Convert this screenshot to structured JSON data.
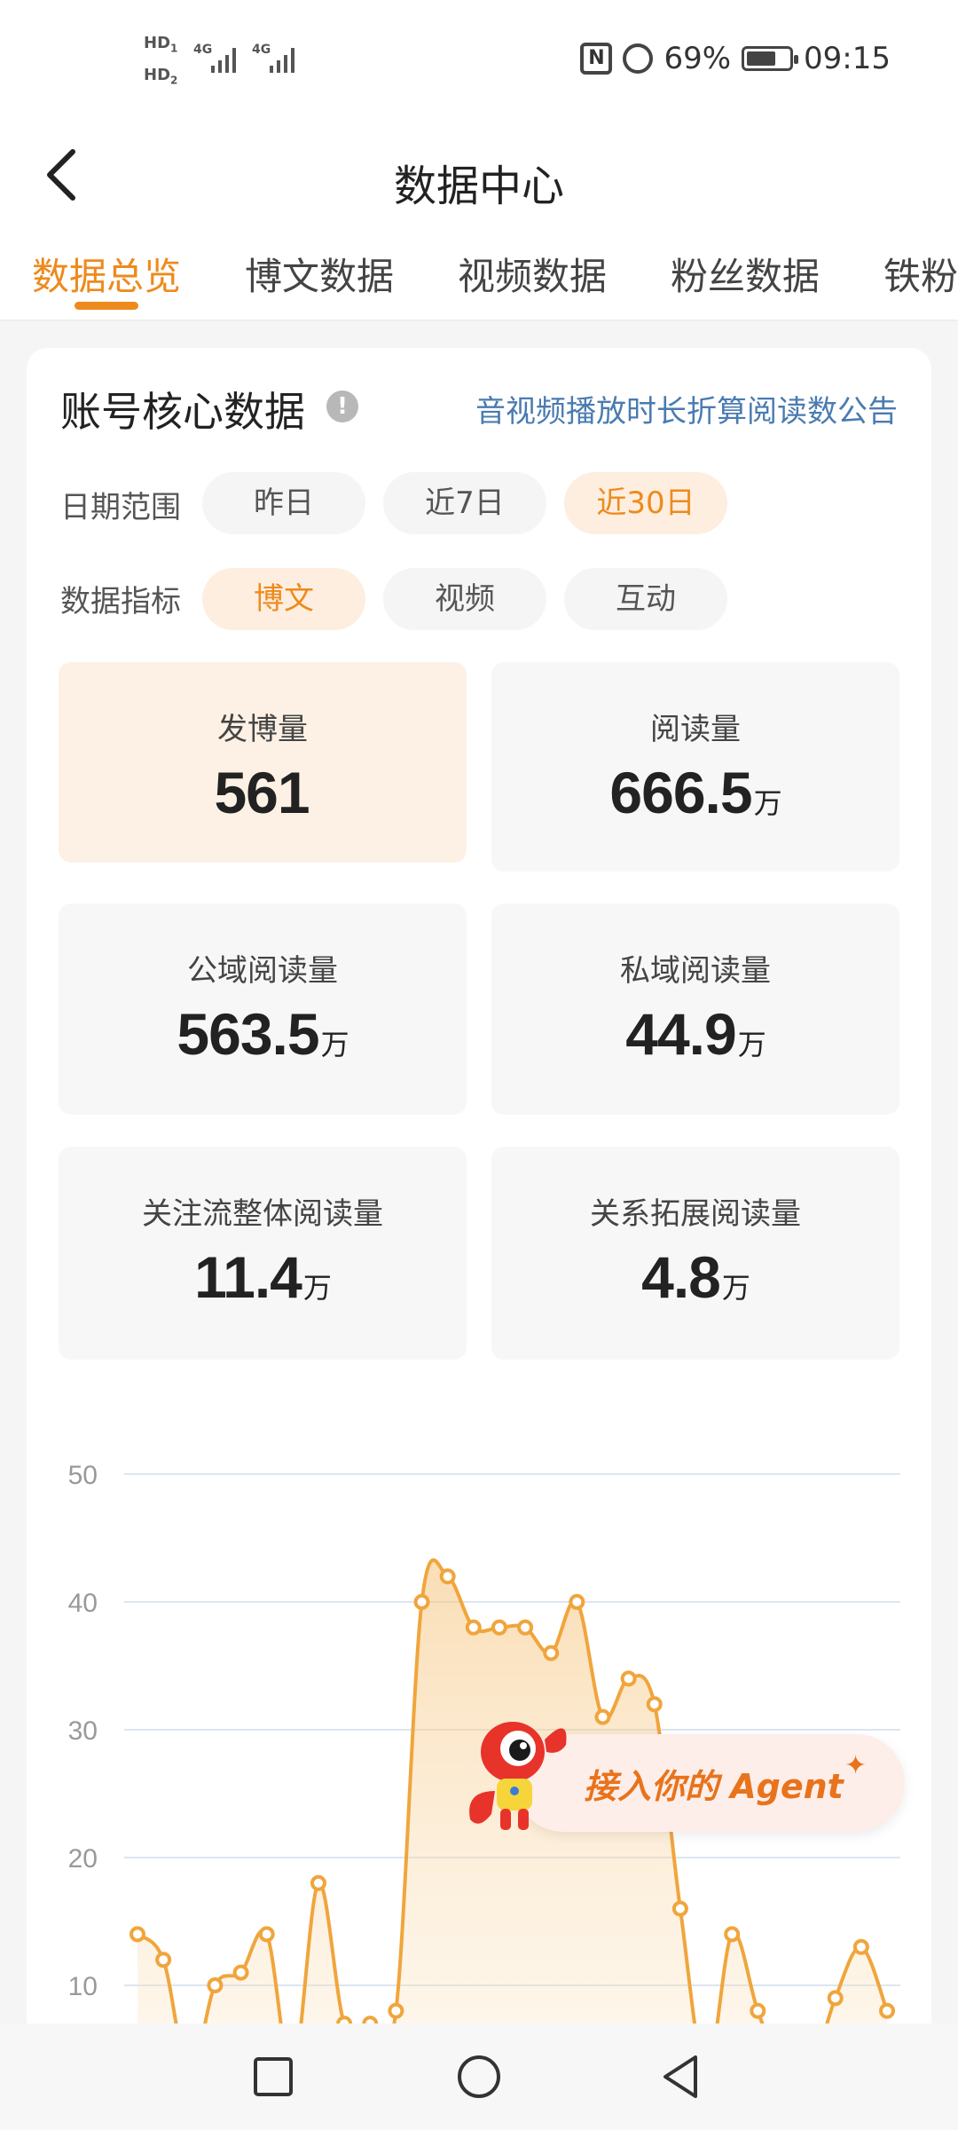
{
  "status_bar": {
    "hd1": "HD",
    "hd1_sub": "1",
    "hd2": "HD",
    "hd2_sub": "2",
    "net1": "4G",
    "net2": "4G",
    "nfc_icon": "nfc-icon",
    "battery_percent": "69%",
    "battery_level": 0.69,
    "time": "09:15"
  },
  "navbar": {
    "title": "数据中心",
    "back_icon": "chevron-left-icon"
  },
  "tabs": [
    {
      "label": "数据总览",
      "active": true
    },
    {
      "label": "博文数据",
      "active": false
    },
    {
      "label": "视频数据",
      "active": false
    },
    {
      "label": "粉丝数据",
      "active": false
    },
    {
      "label": "铁粉",
      "active": false
    }
  ],
  "card": {
    "title": "账号核心数据",
    "info_icon": "!",
    "notice_link": "音视频播放时长折算阅读数公告",
    "date_range": {
      "label": "日期范围",
      "options": [
        "昨日",
        "近7日",
        "近30日"
      ],
      "selected": "近30日"
    },
    "metric_type": {
      "label": "数据指标",
      "options": [
        "博文",
        "视频",
        "互动"
      ],
      "selected": "博文"
    },
    "metrics": [
      {
        "label": "发博量",
        "value": "561",
        "unit": "",
        "active": true
      },
      {
        "label": "阅读量",
        "value": "666.5",
        "unit": "万",
        "active": false
      },
      {
        "label": "公域阅读量",
        "value": "563.5",
        "unit": "万",
        "active": false
      },
      {
        "label": "私域阅读量",
        "value": "44.9",
        "unit": "万",
        "active": false
      },
      {
        "label": "关注流整体阅读量",
        "value": "11.4",
        "unit": "万",
        "active": false
      },
      {
        "label": "关系拓展阅读量",
        "value": "4.8",
        "unit": "万",
        "active": false
      }
    ]
  },
  "chart_data": {
    "type": "area",
    "ylim": [
      0,
      50
    ],
    "yticks": [
      "10",
      "20",
      "30",
      "40",
      "50"
    ],
    "grid": true,
    "color": "#f0a53c",
    "points": [
      14,
      12,
      3,
      10,
      11,
      14,
      3,
      18,
      7,
      7,
      8,
      40,
      42,
      38,
      38,
      38,
      36,
      40,
      31,
      34,
      32,
      16,
      3,
      14,
      8,
      3,
      3,
      9,
      13,
      8
    ]
  },
  "agent_banner": {
    "label": "接入你的 Agent",
    "sparkle": "✦"
  },
  "sysnav": {
    "recent_icon": "square-recent-apps-icon",
    "home_icon": "circle-home-icon",
    "back_icon": "triangle-back-icon"
  },
  "colors": {
    "accent": "#ee8a1c",
    "link": "#4a7bb0",
    "chart_line": "#f0a53c"
  }
}
